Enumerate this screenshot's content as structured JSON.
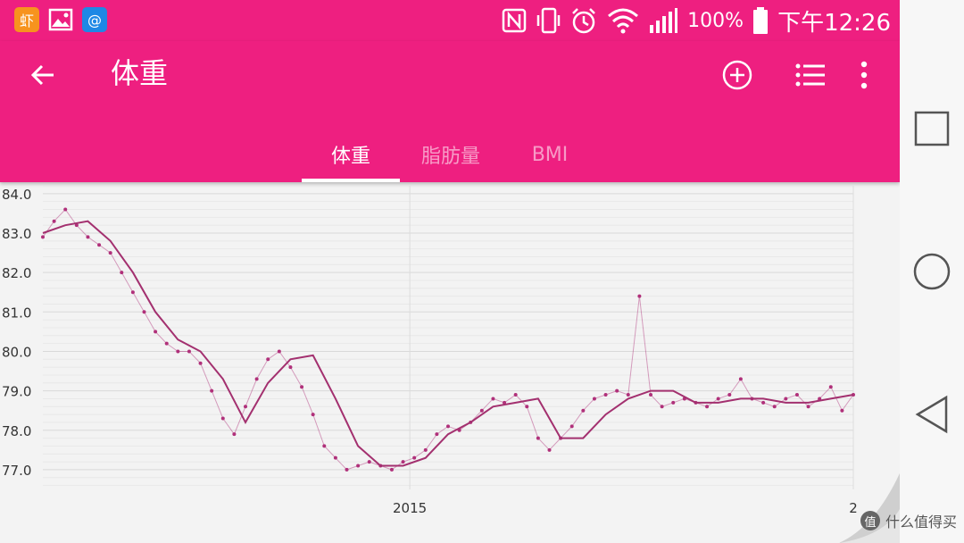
{
  "status_bar": {
    "app_icons": [
      {
        "name": "xia-app-icon",
        "glyph": "虾",
        "color": "#f7931e"
      },
      {
        "name": "gallery-icon",
        "glyph": "▲",
        "color": "#ffffff"
      },
      {
        "name": "email-app-icon",
        "glyph": "@",
        "color": "#1e88e5"
      }
    ],
    "battery": "100%",
    "time": "下午12:26"
  },
  "app_bar": {
    "title": "体重"
  },
  "tabs": [
    {
      "label": "体重",
      "active": true
    },
    {
      "label": "脂肪量",
      "active": false
    },
    {
      "label": "BMI",
      "active": false
    }
  ],
  "colors": {
    "accent": "#ee1f80",
    "series": "#a3306f",
    "point": "#b0307a"
  },
  "watermark": {
    "badge": "值",
    "text": "什么值得买"
  },
  "chart_data": {
    "type": "line",
    "title": "",
    "xlabel": "",
    "ylabel": "",
    "ylim": [
      76.5,
      84.2
    ],
    "yticks": [
      77.0,
      78.0,
      79.0,
      80.0,
      81.0,
      82.0,
      83.0,
      84.0
    ],
    "ytick_labels": [
      "77.0",
      "78.0",
      "79.0",
      "80.0",
      "81.0",
      "82.0",
      "83.0",
      "84.0"
    ],
    "xlim": [
      0,
      360
    ],
    "x_tick_labels": [
      {
        "x": 163,
        "label": "2015"
      },
      {
        "x": 360,
        "label": "2"
      }
    ],
    "grid": true,
    "series": [
      {
        "kind": "daily",
        "x": [
          0,
          5,
          10,
          15,
          20,
          25,
          30,
          35,
          40,
          45,
          50,
          55,
          60,
          65,
          70,
          75,
          80,
          85,
          90,
          95,
          100,
          105,
          110,
          115,
          120,
          125,
          130,
          135,
          140,
          145,
          150,
          155,
          160,
          165,
          170,
          175,
          180,
          185,
          190,
          195,
          200,
          205,
          210,
          215,
          220,
          225,
          230,
          235,
          240,
          245,
          250,
          255,
          260,
          265,
          270,
          275,
          280,
          285,
          290,
          295,
          300,
          305,
          310,
          315,
          320,
          325,
          330,
          335,
          340,
          345,
          350,
          355,
          360
        ],
        "values": [
          82.9,
          83.3,
          83.6,
          83.2,
          82.9,
          82.7,
          82.5,
          82.0,
          81.5,
          81.0,
          80.5,
          80.2,
          80.0,
          80.0,
          79.7,
          79.0,
          78.3,
          77.9,
          78.6,
          79.3,
          79.8,
          80.0,
          79.6,
          79.1,
          78.4,
          77.6,
          77.3,
          77.0,
          77.1,
          77.2,
          77.1,
          77.0,
          77.2,
          77.3,
          77.5,
          77.9,
          78.1,
          78.0,
          78.2,
          78.5,
          78.8,
          78.7,
          78.9,
          78.6,
          77.8,
          77.5,
          77.8,
          78.1,
          78.5,
          78.8,
          78.9,
          79.0,
          78.9,
          81.4,
          78.9,
          78.6,
          78.7,
          78.8,
          78.7,
          78.6,
          78.8,
          78.9,
          79.3,
          78.8,
          78.7,
          78.6,
          78.8,
          78.9,
          78.6,
          78.8,
          79.1,
          78.5,
          78.9
        ]
      },
      {
        "kind": "trend",
        "x": [
          0,
          10,
          20,
          30,
          40,
          50,
          60,
          70,
          80,
          90,
          100,
          110,
          120,
          130,
          140,
          150,
          160,
          170,
          180,
          190,
          200,
          210,
          220,
          230,
          240,
          250,
          260,
          270,
          280,
          290,
          300,
          310,
          320,
          330,
          340,
          350,
          360
        ],
        "values": [
          83.0,
          83.2,
          83.3,
          82.8,
          82.0,
          81.0,
          80.3,
          80.0,
          79.3,
          78.2,
          79.2,
          79.8,
          79.9,
          78.8,
          77.6,
          77.1,
          77.1,
          77.3,
          77.9,
          78.2,
          78.6,
          78.7,
          78.8,
          77.8,
          77.8,
          78.4,
          78.8,
          79.0,
          79.0,
          78.7,
          78.7,
          78.8,
          78.8,
          78.7,
          78.7,
          78.8,
          78.9
        ]
      }
    ]
  }
}
